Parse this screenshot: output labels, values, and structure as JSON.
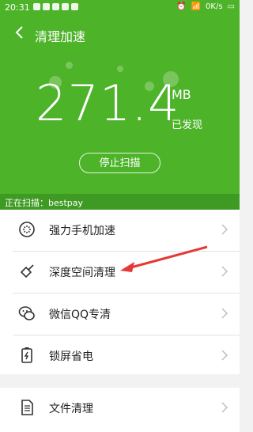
{
  "status_bar": {
    "time": "20:31",
    "network": "0K/s"
  },
  "header": {
    "title": "清理加速"
  },
  "scan": {
    "size_value": "271.4",
    "size_unit": "MB",
    "found_label": "已发现",
    "stop_button": "停止扫描",
    "scanning_text": "正在扫描：bestpay"
  },
  "menu": {
    "items": [
      {
        "label": "强力手机加速",
        "icon": "boost-icon"
      },
      {
        "label": "深度空间清理",
        "icon": "broom-icon"
      },
      {
        "label": "微信QQ专清",
        "icon": "chat-icon"
      },
      {
        "label": "锁屏省电",
        "icon": "battery-icon"
      }
    ],
    "secondary": [
      {
        "label": "文件清理",
        "icon": "file-icon"
      }
    ]
  },
  "colors": {
    "primary_green": "#4db329",
    "scanbar_green": "#3f9a23",
    "annotation_red": "#e53935"
  }
}
